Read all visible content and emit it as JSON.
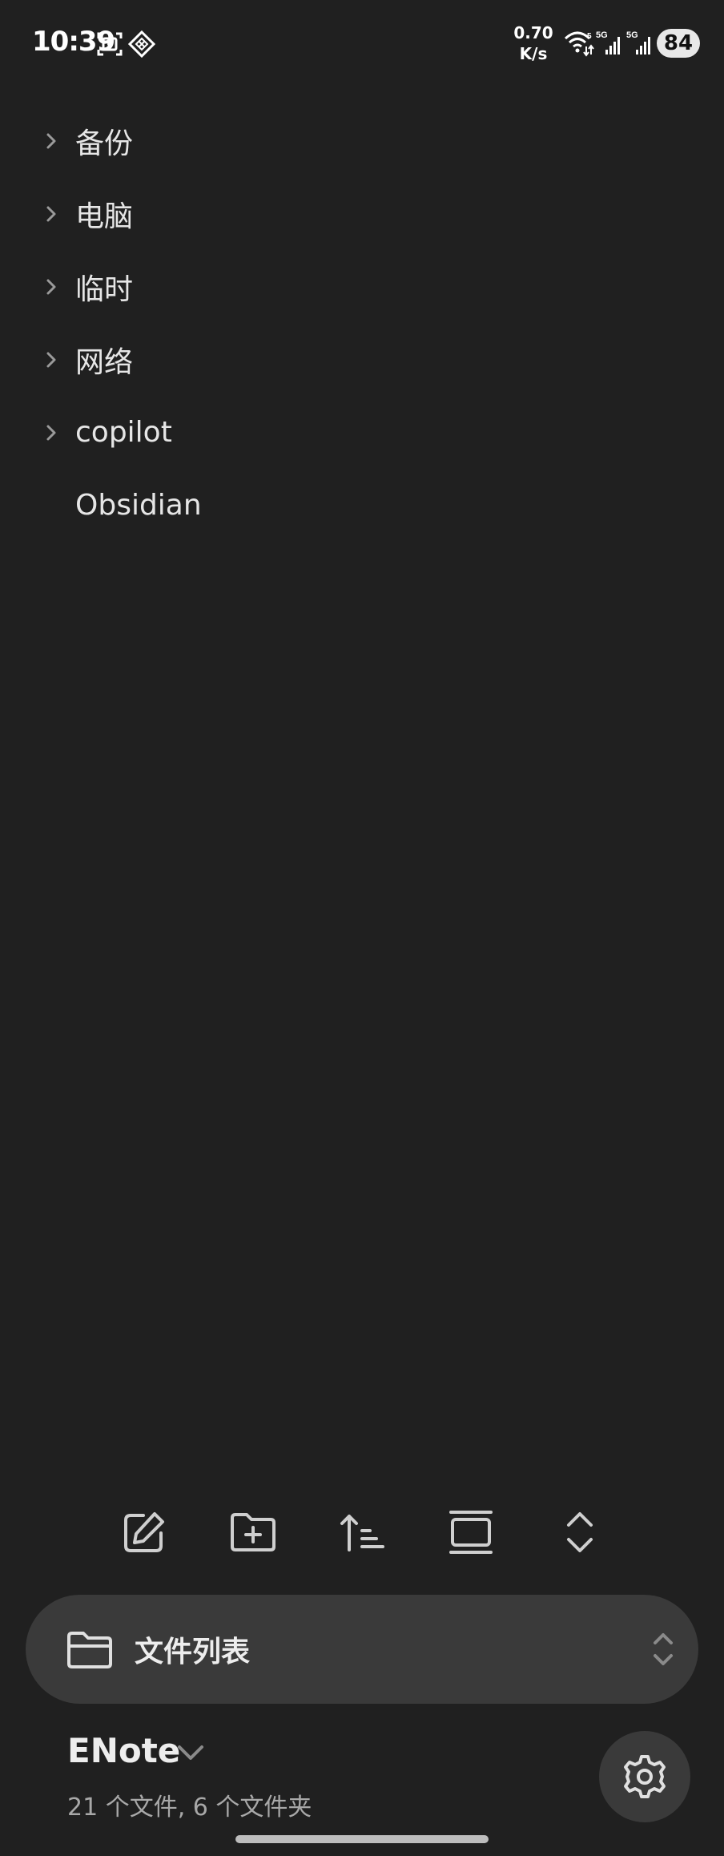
{
  "status_bar": {
    "time": "10:39",
    "net_speed_value": "0.70",
    "net_speed_unit": "K/s",
    "battery": "84",
    "icons": [
      "screenshot-icon",
      "vpn-diamond-icon",
      "wifi-icon",
      "signal-5g-icon",
      "signal-5g-icon"
    ]
  },
  "tree": {
    "items": [
      {
        "label": "备份",
        "has_children": true
      },
      {
        "label": "电脑",
        "has_children": true
      },
      {
        "label": "临时",
        "has_children": true
      },
      {
        "label": "网络",
        "has_children": true
      },
      {
        "label": "copilot",
        "has_children": true
      },
      {
        "label": "Obsidian",
        "has_children": false
      }
    ]
  },
  "toolbar": {
    "icons": [
      "new-note-icon",
      "new-folder-icon",
      "sort-icon",
      "collapse-view-icon",
      "expand-collapse-icon"
    ]
  },
  "selector": {
    "label": "文件列表"
  },
  "footer": {
    "vault_name": "ENote",
    "stats": "21 个文件, 6 个文件夹"
  },
  "colors": {
    "background": "#202020",
    "pill": "#3a3a3a",
    "text": "#e6e6e6",
    "muted": "#a8a8a8"
  }
}
